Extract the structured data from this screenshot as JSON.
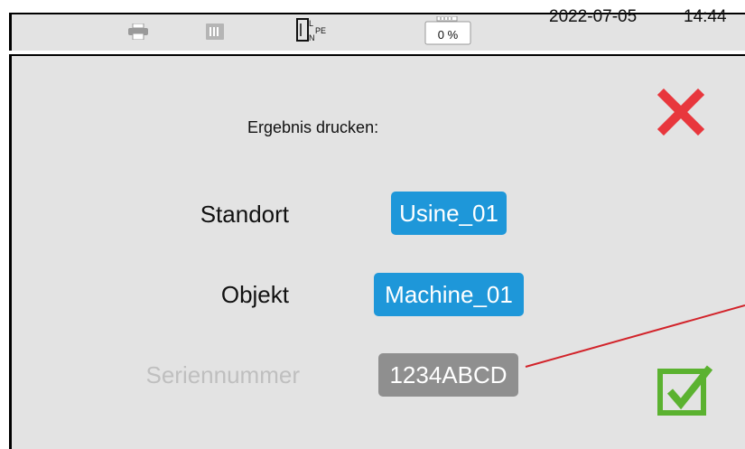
{
  "status_bar": {
    "icons": [
      "printer-icon",
      "memory-card-icon",
      "network-lnpe-icon",
      "battery-icon"
    ],
    "network_labels": {
      "l": "L",
      "n": "N",
      "pe": "PE"
    },
    "battery_text": "0 %",
    "date": "2022-07-05",
    "time": "14:44"
  },
  "dialog": {
    "prompt": "Ergebnis drucken:",
    "fields": [
      {
        "label": "Standort",
        "value": "Usine_01",
        "state": "active"
      },
      {
        "label": "Objekt",
        "value": "Machine_01",
        "state": "active"
      },
      {
        "label": "Seriennummer",
        "value": "1234ABCD",
        "state": "disabled"
      }
    ],
    "close_icon": "red-x-icon",
    "confirm_icon": "green-check-icon"
  },
  "colors": {
    "background": "#e3e3e3",
    "field_active": "#1e97d9",
    "field_disabled": "#8f8f8f",
    "label_disabled": "#bfbfbf",
    "close": "#e8373d",
    "confirm": "#5bb230",
    "annotation": "#d2232a"
  }
}
